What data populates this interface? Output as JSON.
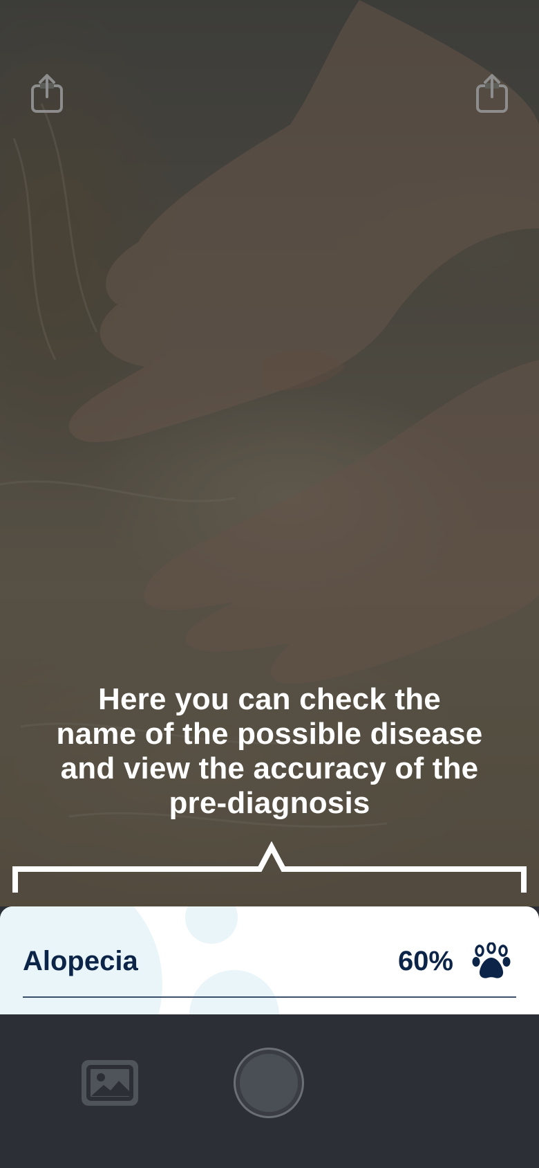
{
  "overlay": {
    "hint_line_1": "Here you can check the",
    "hint_line_2": "name of the possible disease",
    "hint_line_3": "and view the accuracy of the",
    "hint_line_4": "pre-diagnosis"
  },
  "result": {
    "disease_name": "Alopecia",
    "accuracy": "60%"
  },
  "icons": {
    "share_left": "share-icon",
    "share_right": "share-icon",
    "result_icon": "paw-icon",
    "gallery": "image-icon",
    "shutter": "shutter-button"
  },
  "colors": {
    "accent_navy": "#0b2447",
    "bubble_blue": "#eaf5fa",
    "bottom_bar": "#2c3036"
  }
}
